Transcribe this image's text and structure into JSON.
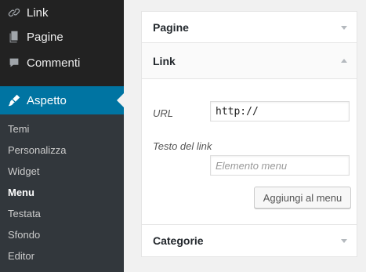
{
  "sidebar": {
    "menu": [
      {
        "label": "Link",
        "icon": "link-icon"
      },
      {
        "label": "Pagine",
        "icon": "pages-icon"
      },
      {
        "label": "Commenti",
        "icon": "comments-icon"
      }
    ],
    "active_menu": {
      "label": "Aspetto",
      "icon": "appearance-brush-icon"
    },
    "submenu": [
      "Temi",
      "Personalizza",
      "Widget",
      "Menu",
      "Testata",
      "Sfondo",
      "Editor"
    ],
    "submenu_current": "Menu"
  },
  "accordion": {
    "sections": [
      "Pagine",
      "Link",
      "Categorie"
    ],
    "open_section": "Link",
    "link_form": {
      "url_label": "URL",
      "url_value": "http://",
      "link_text_label": "Testo del link",
      "link_text_placeholder": "Elemento menu",
      "add_button": "Aggiungi al menu"
    }
  },
  "colors": {
    "sidebar_bg": "#222222",
    "submenu_bg": "#32373c",
    "active_bg": "#0074a2",
    "page_bg": "#f1f1f1"
  }
}
